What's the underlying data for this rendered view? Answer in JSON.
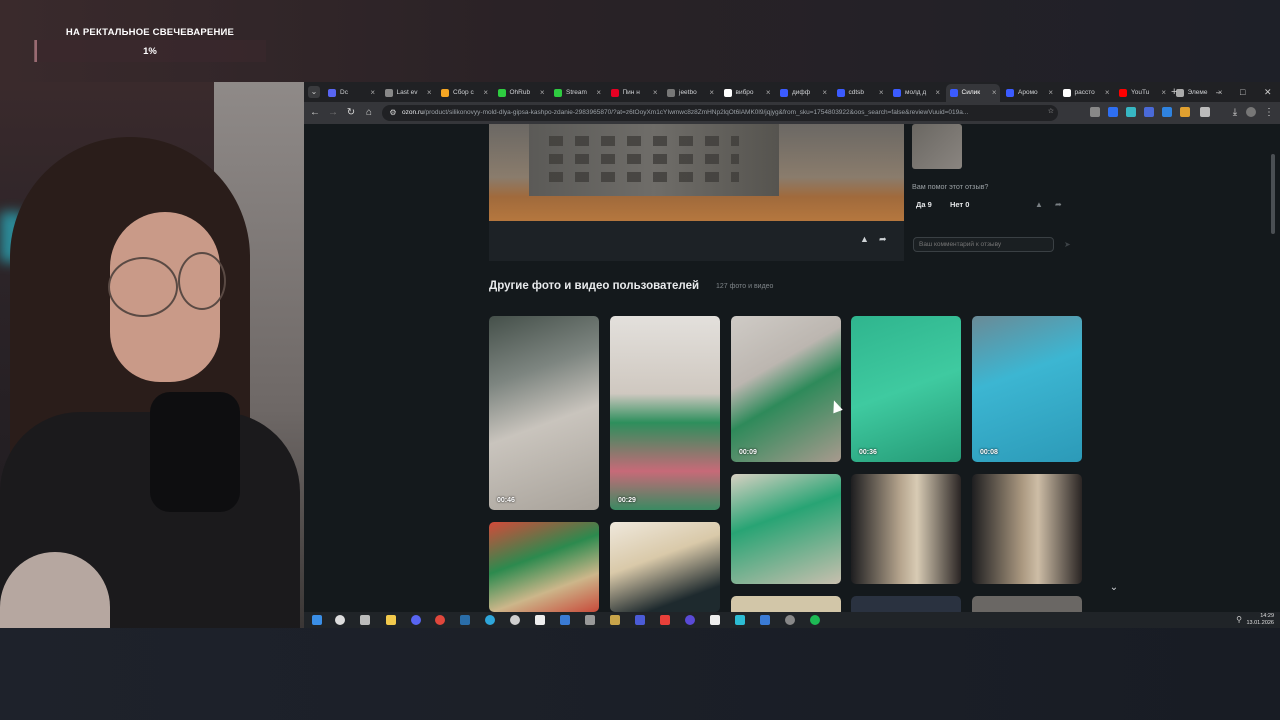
{
  "overlay": {
    "goal_title": "НА РЕКТАЛЬНОЕ СВЕЧЕВАРЕНИЕ",
    "goal_percent": "1%",
    "goal_progress": 0.01
  },
  "browser": {
    "tabs": [
      {
        "label": "Dc",
        "color": "#5865f2",
        "active": false
      },
      {
        "label": "Last ev",
        "color": "#888888",
        "active": false
      },
      {
        "label": "Сбор с",
        "color": "#f5a623",
        "active": false
      },
      {
        "label": "OhRub",
        "color": "#2ecc40",
        "active": false
      },
      {
        "label": "Stream",
        "color": "#2ecc40",
        "active": false
      },
      {
        "label": "Пин н",
        "color": "#e60023",
        "active": false
      },
      {
        "label": "jeetbo",
        "color": "#777777",
        "active": false
      },
      {
        "label": "вибро",
        "color": "#ffffff",
        "active": false
      },
      {
        "label": "дифф",
        "color": "#3b5bff",
        "active": false
      },
      {
        "label": "cdtsb",
        "color": "#3b5bff",
        "active": false
      },
      {
        "label": "молд д",
        "color": "#3b5bff",
        "active": false
      },
      {
        "label": "Силик",
        "color": "#3b5bff",
        "active": true
      },
      {
        "label": "Аромо",
        "color": "#3b5bff",
        "active": false
      },
      {
        "label": "рассто",
        "color": "#ffffff",
        "active": false
      },
      {
        "label": "YouTu",
        "color": "#ff0000",
        "active": false
      },
      {
        "label": "Элеме",
        "color": "#aaaaaa",
        "active": false
      }
    ],
    "new_tab": "+",
    "url_host": "ozon.ru",
    "url_path": "/product/silikonovyy-mold-dlya-gipsa-kashpo-zdanie-2983965870/?at=z6tOoyXm1cYIwmwc8z8ZmHNp2lqOt6lAMK0l9/jqjyg&from_sku=1754803922&oos_search=false&reviewVuuid=019a..."
  },
  "review": {
    "helpful_question": "Вам помог этот отзыв?",
    "yes_label": "Да 9",
    "no_label": "Нет 0",
    "comment_placeholder": "Ваш комментарий к отзыву"
  },
  "gallery": {
    "title": "Другие фото и видео пользователей",
    "count": "127 фото и видео",
    "durations": [
      "00:46",
      "00:29",
      "00:09",
      "00:36",
      "00:08"
    ]
  },
  "taskbar": {
    "time": "14:29",
    "date": "13.01.2026"
  }
}
